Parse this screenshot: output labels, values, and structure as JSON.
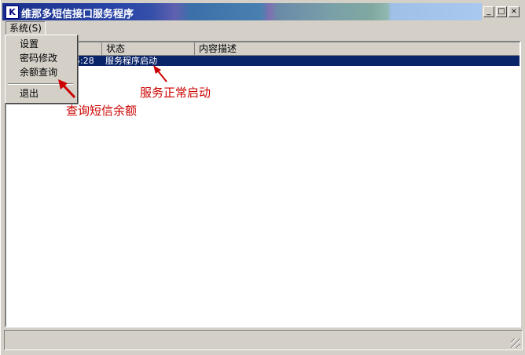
{
  "window": {
    "title": "维那多短信接口服务程序",
    "icon_name": "app-logo-icon",
    "controls": {
      "minimize": "_",
      "maximize": "□",
      "close": "×"
    }
  },
  "menubar": {
    "system_menu": "系统(S)"
  },
  "system_menu_items": [
    {
      "label": "设置"
    },
    {
      "label": "密码修改"
    },
    {
      "label": "余额查询"
    },
    {
      "label": "退出"
    }
  ],
  "log_table": {
    "columns": [
      "",
      "状态",
      "内容描述"
    ],
    "rows": [
      {
        "time": "5:28",
        "status": "服务程序启动",
        "description": "",
        "selected": true
      }
    ]
  },
  "annotations": {
    "service_started": "服务正常启动",
    "query_balance": "查询短信余额",
    "color": "#cc0000"
  },
  "colors": {
    "selection": "#0a246a",
    "face": "#d4d0c8",
    "title_start": "#1a2f8c"
  }
}
